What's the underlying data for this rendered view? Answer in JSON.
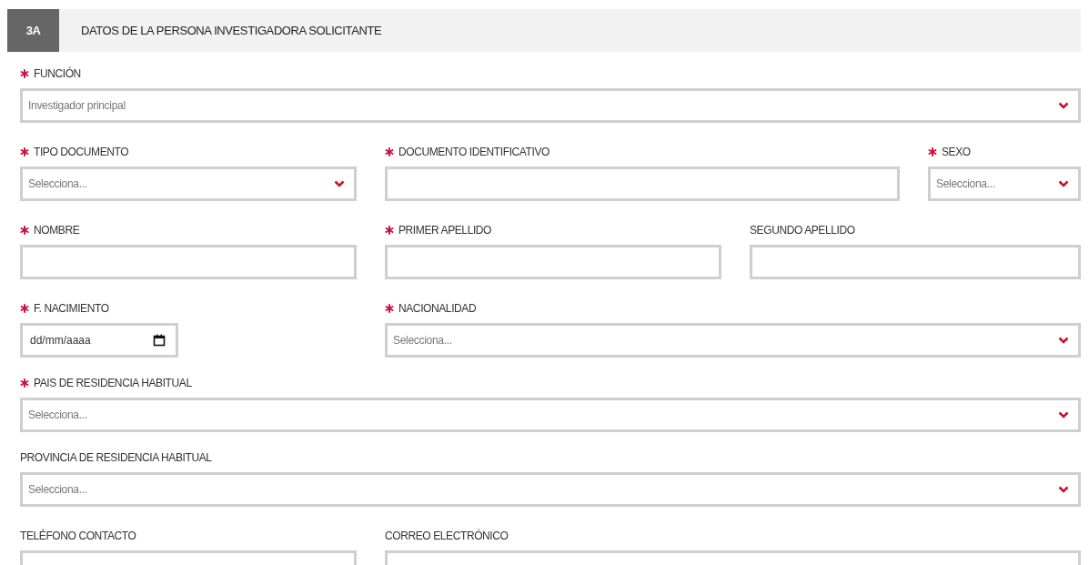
{
  "section": {
    "number": "3A",
    "title": "DATOS DE LA PERSONA INVESTIGADORA SOLICITANTE"
  },
  "rows": [
    {
      "fields": [
        {
          "label": "FUNCIÓN",
          "required": true,
          "kind": "select",
          "value": "Investigador principal"
        }
      ]
    },
    {
      "fields": [
        {
          "label": "TIPO DOCUMENTO",
          "required": true,
          "kind": "select",
          "value": "Selecciona..."
        },
        {
          "label": "DOCUMENTO IDENTIFICATIVO",
          "required": true,
          "kind": "text"
        },
        {
          "label": "SEXO",
          "required": true,
          "kind": "select",
          "value": "Selecciona..."
        }
      ]
    },
    {
      "fields": [
        {
          "label": "NOMBRE",
          "required": true,
          "kind": "text"
        },
        {
          "label": "PRIMER APELLIDO",
          "required": true,
          "kind": "text"
        },
        {
          "label": "SEGUNDO APELLIDO",
          "required": false,
          "kind": "text"
        }
      ]
    },
    {
      "fields": [
        {
          "label": "F. NACIMIENTO",
          "required": true,
          "kind": "date",
          "placeholder": "dd/mm/aaaa"
        },
        {
          "label": "NACIONALIDAD",
          "required": true,
          "kind": "select",
          "value": "Selecciona..."
        }
      ]
    },
    {
      "fields": [
        {
          "label": "PAIS DE RESIDENCIA HABITUAL",
          "required": true,
          "kind": "select",
          "value": "Selecciona..."
        }
      ]
    },
    {
      "fields": [
        {
          "label": "PROVINCIA DE RESIDENCIA HABITUAL",
          "required": false,
          "kind": "select",
          "value": "Selecciona..."
        }
      ]
    },
    {
      "fields": [
        {
          "label": "TELÉFONO CONTACTO",
          "required": false,
          "kind": "text"
        },
        {
          "label": "CORREO ELECTRÓNICO",
          "required": false,
          "kind": "text"
        }
      ]
    }
  ]
}
